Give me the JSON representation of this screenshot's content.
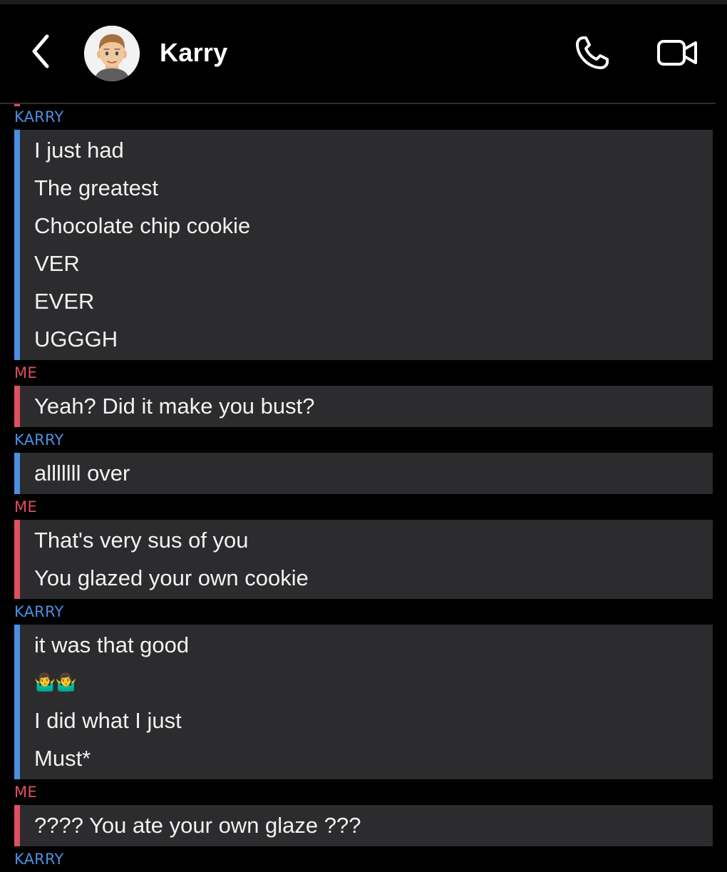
{
  "header": {
    "contact_name": "Karry",
    "back_icon": "chevron-left-icon",
    "call_icon": "phone-icon",
    "video_icon": "video-camera-icon"
  },
  "colors": {
    "background": "#000000",
    "bubble": "#2c2c2e",
    "them_accent": "#4a90e2",
    "me_accent": "#e0505e",
    "text": "#f2f2f2"
  },
  "messages": [
    {
      "sender": "KARRY",
      "from": "them",
      "lines": [
        "I just had",
        "The greatest",
        "Chocolate chip cookie",
        "VER",
        "EVER",
        "UGGGH"
      ]
    },
    {
      "sender": "ME",
      "from": "me",
      "lines": [
        "Yeah? Did it make you bust?"
      ]
    },
    {
      "sender": "KARRY",
      "from": "them",
      "lines": [
        "alllllll over"
      ]
    },
    {
      "sender": "ME",
      "from": "me",
      "lines": [
        "That's very sus of you",
        "You glazed your own cookie"
      ]
    },
    {
      "sender": "KARRY",
      "from": "them",
      "lines": [
        "it was that good",
        "🤷‍♂️🤷‍♂️",
        "I did what I just",
        "Must*"
      ]
    },
    {
      "sender": "ME",
      "from": "me",
      "lines": [
        "???? You ate your own glaze ???"
      ]
    }
  ],
  "trailing_sender": "KARRY"
}
